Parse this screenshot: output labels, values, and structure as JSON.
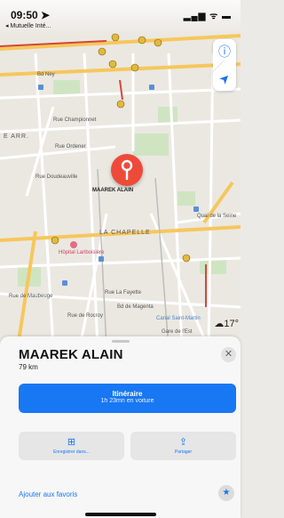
{
  "status_bar": {
    "time": "09:50 ➤",
    "back_label": "◂ Mutuelle Inté...",
    "icons": "▂▄▆ ᯤ ▬"
  },
  "map": {
    "pin_label": "MAAREK ALAIN",
    "street_labels": [
      "Bd Ney",
      "Rue Championnet",
      "Rue Ordener",
      "Rue Doudeauville",
      "LA CHAPELLE",
      "Hôpital Lariboisière",
      "Rue de Maubeuge",
      "Rue La Fayette",
      "E ARR.",
      "Gare de l'Est",
      "Canal Saint-Martin",
      "Quai de la Seine",
      "Bd de Magenta",
      "Rue de Rocroy"
    ],
    "weather": "☁17°",
    "controls": {
      "info_icon": "ⓘ",
      "location_icon": "➤"
    }
  },
  "sheet": {
    "title": "MAAREK ALAIN",
    "distance": "79 km",
    "close_icon": "✕",
    "route_button": {
      "label": "Itinéraire",
      "sublabel": "1h 23mn en voiture"
    },
    "save_button": {
      "icon": "⊞",
      "label": "Enregistrer dans..."
    },
    "share_button": {
      "icon": "⇪",
      "label": "Partager"
    },
    "favorites_label": "Ajouter aux favoris",
    "star_icon": "★"
  },
  "colors": {
    "accent": "#1877f2",
    "pin": "#ee4a3a",
    "road_major": "#f6c75b",
    "road_red": "#d2473a"
  }
}
